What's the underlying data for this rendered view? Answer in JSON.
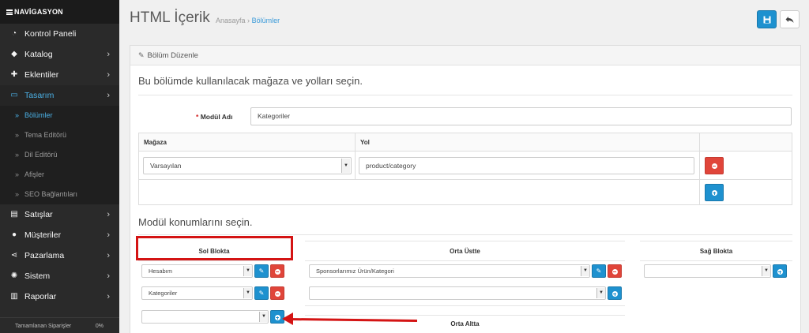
{
  "sidebar": {
    "header": "NAVİGASYON",
    "items": [
      {
        "label": "Kontrol Paneli",
        "icon": "dashboard-icon",
        "chevron": false
      },
      {
        "label": "Katalog",
        "icon": "tags-icon",
        "chevron": true
      },
      {
        "label": "Eklentiler",
        "icon": "puzzle-icon",
        "chevron": true
      },
      {
        "label": "Tasarım",
        "icon": "monitor-icon",
        "chevron": true,
        "active": true
      },
      {
        "label": "Satışlar",
        "icon": "cart-icon",
        "chevron": true
      },
      {
        "label": "Müşteriler",
        "icon": "user-icon",
        "chevron": true
      },
      {
        "label": "Pazarlama",
        "icon": "share-icon",
        "chevron": true
      },
      {
        "label": "Sistem",
        "icon": "gear-icon",
        "chevron": true
      },
      {
        "label": "Raporlar",
        "icon": "bar-chart-icon",
        "chevron": true
      }
    ],
    "subitems": [
      {
        "label": "Bölümler",
        "active": true
      },
      {
        "label": "Tema Editörü"
      },
      {
        "label": "Dil Editörü"
      },
      {
        "label": "Afişler"
      },
      {
        "label": "SEO Bağlantıları"
      }
    ],
    "footer": {
      "label": "Tamamlanan Siparişler",
      "value": "0%"
    }
  },
  "header": {
    "title": "HTML İçerik",
    "breadcrumb_home": "Anasayfa",
    "breadcrumb_sep": "›",
    "breadcrumb_current": "Bölümler",
    "save_icon": "save-icon",
    "back_icon": "reply-icon"
  },
  "panel": {
    "title": "Bölüm Düzenle",
    "section1": "Bu bölümde kullanılacak mağaza ve yolları seçin.",
    "module_label_required": "*",
    "module_label": "Modül Adı",
    "module_value": "Kategoriler",
    "table": {
      "col_store": "Mağaza",
      "col_route": "Yol",
      "row_store": "Varsayılan",
      "row_route": "product/category"
    },
    "section2": "Modül konumlarını seçin.",
    "positions": {
      "left": {
        "title": "Sol Blokta",
        "rows": [
          "Hesabım",
          "Kategoriler",
          ""
        ]
      },
      "top": {
        "title": "Orta Üstte",
        "rows": [
          "Sponsorlarımız Ürün/Kategori",
          ""
        ]
      },
      "right": {
        "title": "Sağ Blokta",
        "rows": [
          ""
        ]
      },
      "bottom": {
        "title": "Orta Altta"
      }
    }
  },
  "colors": {
    "primary": "#1e91cf",
    "danger": "#e0453a",
    "annotation": "#d41414"
  }
}
